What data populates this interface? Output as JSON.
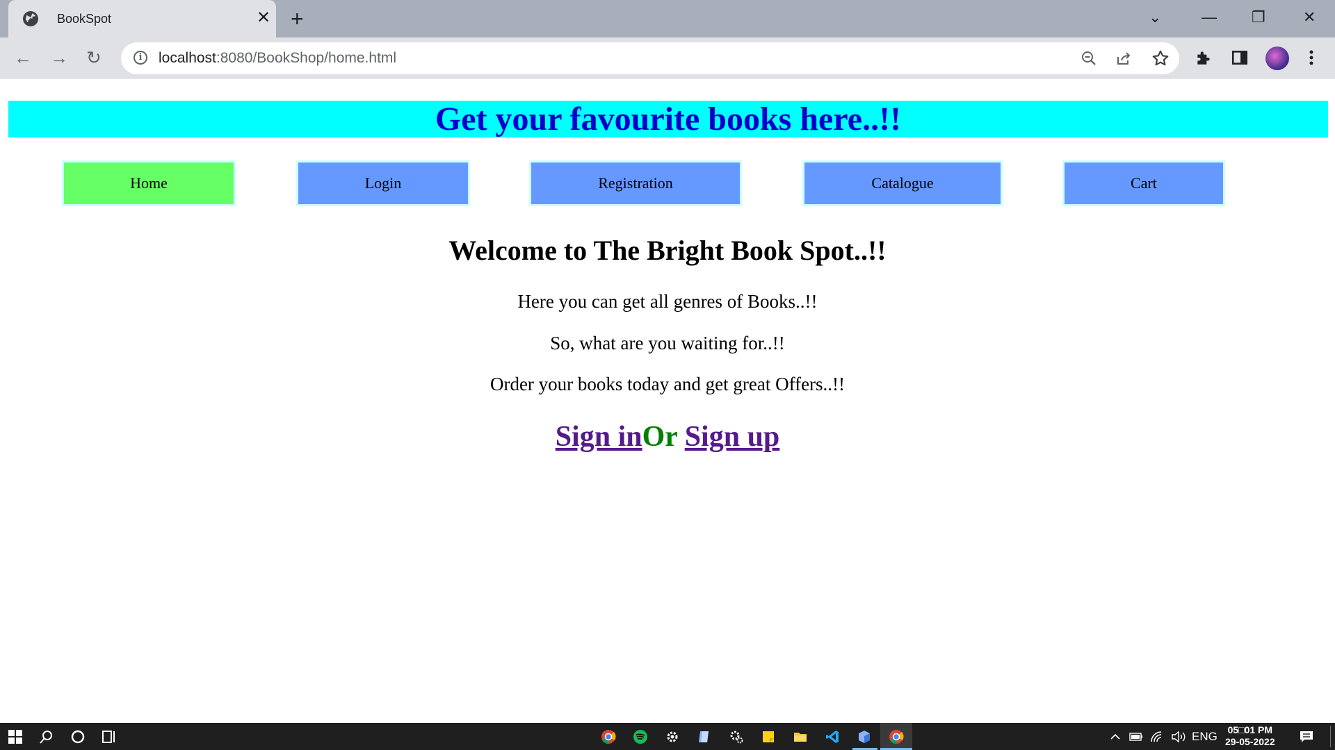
{
  "browser": {
    "tab_title": "BookSpot",
    "tab_close": "✕",
    "new_tab": "+",
    "url_host": "localhost",
    "url_path": ":8080/BookShop/home.html",
    "controls": {
      "tab_search": "⌄",
      "minimize": "—",
      "restore": "❐",
      "close": "✕"
    },
    "nav": {
      "back": "←",
      "forward": "→",
      "reload": "↻"
    },
    "icons": {
      "zoom": "zoom-out-icon",
      "share": "share-icon",
      "star": "bookmark-star-icon",
      "extensions": "puzzle-icon",
      "sidepanel": "side-panel-icon",
      "menu": "kebab-menu-icon"
    }
  },
  "page": {
    "banner": "Get your favourite books here..!!",
    "nav": [
      {
        "label": "Home",
        "color": "#66ff66"
      },
      {
        "label": "Login",
        "color": "#6699ff"
      },
      {
        "label": "Registration",
        "color": "#6699ff"
      },
      {
        "label": "Catalogue",
        "color": "#6699ff"
      },
      {
        "label": "Cart",
        "color": "#6699ff"
      }
    ],
    "welcome": "Welcome to The Bright Book Spot..!!",
    "lines": [
      "Here you can get all genres of Books..!!",
      "So, what are you waiting for..!!",
      "Order your books today and get great Offers..!!"
    ],
    "sign_in": "Sign in",
    "or": "Or",
    "sign_up": "Sign up"
  },
  "taskbar": {
    "time": "05□01 PM",
    "date": "29-05-2022",
    "lang": "ENG"
  },
  "colors": {
    "banner_bg": "#00ffff",
    "banner_text": "#0000cd",
    "link": "#551a8b",
    "or_text": "#008000"
  }
}
